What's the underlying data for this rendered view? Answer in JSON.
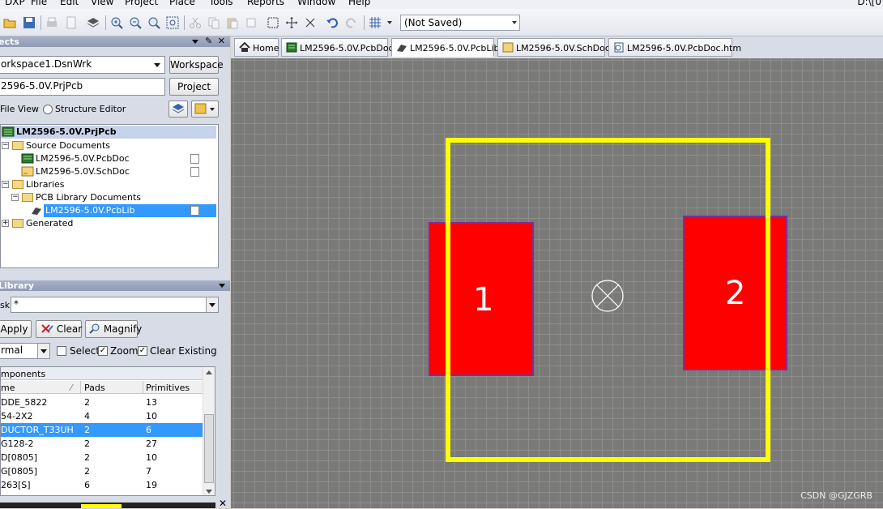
{
  "menu": [
    "DXP",
    "File",
    "Edit",
    "View",
    "Project",
    "Place",
    "Tools",
    "Reports",
    "Window",
    "Help"
  ],
  "path_text": "D:\\[0",
  "toolbar": {
    "save_state": "(Not Saved)"
  },
  "projects_panel": {
    "title": "ects",
    "workspace_value": "orkspace1.DsnWrk",
    "workspace_button": "Workspace",
    "project_value": "2596-5.0V.PrjPcb",
    "project_button": "Project",
    "file_view": "File View",
    "structure_editor": "Structure Editor",
    "tree": {
      "project": "LM2596-5.0V.PrjPcb",
      "source_documents": "Source Documents",
      "pcb_doc": "LM2596-5.0V.PcbDoc",
      "sch_doc": "LM2596-5.0V.SchDoc",
      "libraries": "Libraries",
      "pcb_library_documents": "PCB Library Documents",
      "pcb_lib": "LM2596-5.0V.PcbLib",
      "generated": "Generated"
    }
  },
  "library_panel": {
    "title": "Library",
    "mask_label": "sk",
    "mask_value": "*",
    "apply": "Apply",
    "clear": "Clear",
    "magnify": "Magnify",
    "mode_value": "rmal",
    "select": "Select",
    "zoom": "Zoom",
    "clear_existing": "Clear Existing",
    "components_header": "mponents",
    "columns": [
      "me",
      "Pads",
      "Primitives"
    ],
    "rows": [
      [
        "DDE_5822",
        "2",
        "13"
      ],
      [
        "54-2X2",
        "4",
        "10"
      ],
      [
        "DUCTOR_T33UH",
        "2",
        "6"
      ],
      [
        "G128-2",
        "2",
        "27"
      ],
      [
        "D[0805]",
        "2",
        "10"
      ],
      [
        "G[0805]",
        "2",
        "7"
      ],
      [
        "263[S]",
        "6",
        "19"
      ]
    ],
    "selected_row": 2
  },
  "tabs": [
    "Home",
    "LM2596-5.0V.PcbDoc",
    "LM2596-5.0V.PcbLib",
    "LM2596-5.0V.SchDoc",
    "LM2596-5.0V.PcbDoc.htm"
  ],
  "canvas": {
    "pad1": "1",
    "pad2": "2",
    "watermark": "CSDN @GJZGRB"
  },
  "colors": {
    "pad": "#ff0000",
    "pad_outline": "#7a2f9a",
    "silkscreen": "#ffff00",
    "canvas_bg": "#7a7a78",
    "selection": "#3399ff"
  }
}
